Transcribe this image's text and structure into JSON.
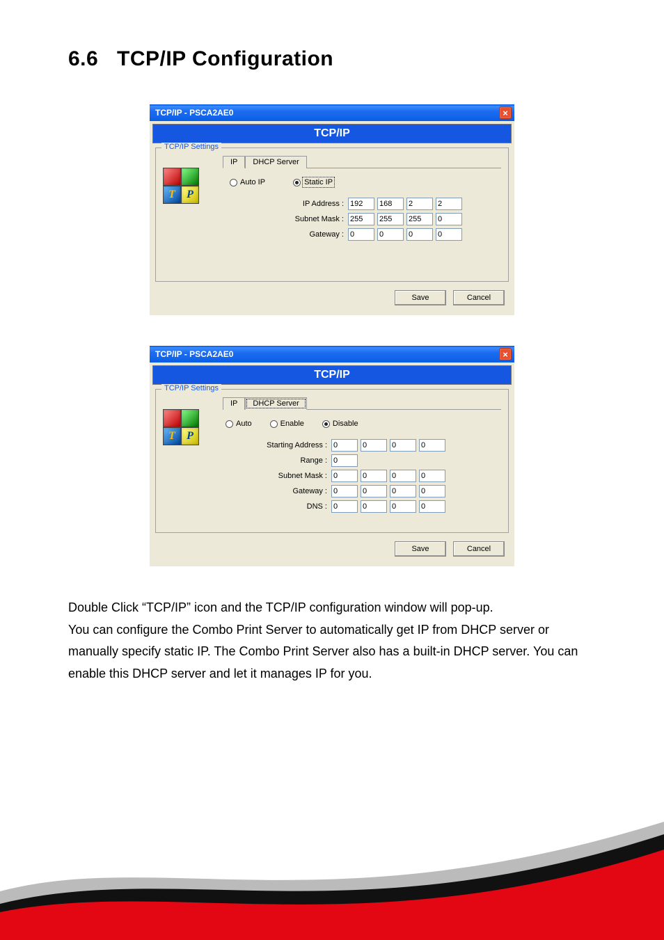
{
  "heading": {
    "number": "6.6",
    "title": "TCP/IP Configuration"
  },
  "dialog1": {
    "window_title": "TCP/IP - PSCA2AE0",
    "banner": "TCP/IP",
    "group_legend": "TCP/IP Settings",
    "tab_ip": "IP",
    "tab_dhcp": "DHCP Server",
    "radio_auto": "Auto IP",
    "radio_static": "Static IP",
    "lbl_ip": "IP Address :",
    "lbl_mask": "Subnet Mask :",
    "lbl_gw": "Gateway :",
    "ip": [
      "192",
      "168",
      "2",
      "2"
    ],
    "mask": [
      "255",
      "255",
      "255",
      "0"
    ],
    "gw": [
      "0",
      "0",
      "0",
      "0"
    ],
    "save": "Save",
    "cancel": "Cancel"
  },
  "dialog2": {
    "window_title": "TCP/IP - PSCA2AE0",
    "banner": "TCP/IP",
    "group_legend": "TCP/IP Settings",
    "tab_ip": "IP",
    "tab_dhcp": "DHCP Server",
    "radio_auto": "Auto",
    "radio_enable": "Enable",
    "radio_disable": "Disable",
    "lbl_start": "Starting Address :",
    "lbl_range": "Range :",
    "lbl_mask": "Subnet Mask :",
    "lbl_gw": "Gateway :",
    "lbl_dns": "DNS :",
    "start": [
      "0",
      "0",
      "0",
      "0"
    ],
    "range": [
      "0"
    ],
    "mask": [
      "0",
      "0",
      "0",
      "0"
    ],
    "gw": [
      "0",
      "0",
      "0",
      "0"
    ],
    "dns": [
      "0",
      "0",
      "0",
      "0"
    ],
    "save": "Save",
    "cancel": "Cancel"
  },
  "paragraph": "Double Click “TCP/IP” icon and the TCP/IP configuration window will pop-up.\nYou can configure the Combo Print Server to automatically get IP from DHCP server or manually specify static IP. The Combo Print Server also has a built-in DHCP server. You can enable this DHCP server and let it manages IP for you."
}
